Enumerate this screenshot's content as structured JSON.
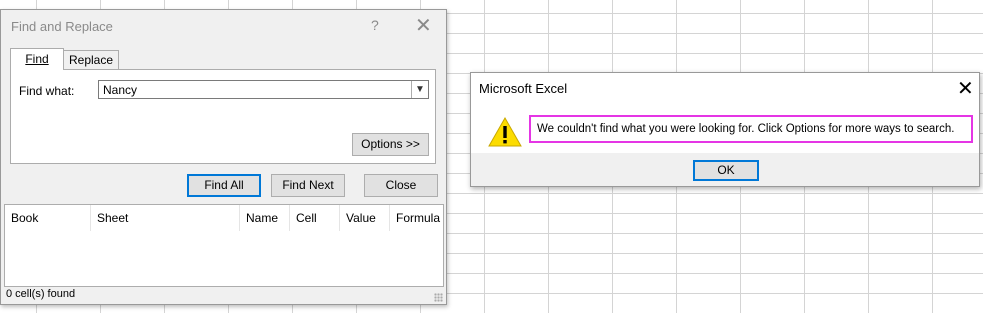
{
  "find_replace": {
    "title": "Find and Replace",
    "help": "?",
    "close": "✕",
    "tabs": {
      "find": "Find",
      "replace": "Replace"
    },
    "find_what_label": "Find what:",
    "find_what_value": "Nancy",
    "options_label": "Options >>",
    "buttons": {
      "find_all": "Find All",
      "find_next": "Find Next",
      "close": "Close"
    },
    "columns": [
      "Book",
      "Sheet",
      "Name",
      "Cell",
      "Value",
      "Formula"
    ],
    "status": "0 cell(s) found"
  },
  "excel_msg": {
    "title": "Microsoft Excel",
    "close": "✕",
    "message": "We couldn't find what you were looking for. Click Options for more ways to search.",
    "ok_label": "OK",
    "warning_icon": "warning-icon",
    "highlight_color": "#e535e5"
  }
}
